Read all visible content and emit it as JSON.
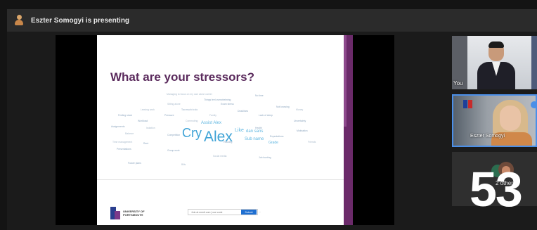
{
  "topbar": {
    "presenting_text": "Eszter Somogyi is presenting",
    "icon": "presenter-avatar-icon"
  },
  "slide": {
    "title": "What are your stressors?",
    "word_cloud": {
      "large_words": [
        "Cry",
        "Alex"
      ],
      "medium_words": [
        "Like",
        "dan sans",
        "Sub name",
        "Assist Alex",
        "Grade"
      ],
      "small_words": [
        "Managing to focus on my own alone career",
        "No time",
        "Things feel overwhelming",
        "Sitting alone",
        "Exam stress",
        "Not knowing",
        "Leaving work",
        "Too much to do",
        "Deadlines",
        "Money",
        "Feeling stuck",
        "Pressure",
        "Family",
        "Lack of sleep",
        "Workload",
        "Commuting",
        "Uncertainty",
        "Assignments",
        "Isolation",
        "Health",
        "Motivation",
        "Balance",
        "Competition",
        "Expectations",
        "Time management",
        "Rent",
        "Housing",
        "Friends",
        "Presentations",
        "Group work",
        "Social media",
        "Job hunting",
        "Future plans",
        "Bills"
      ]
    },
    "logo_text": [
      "UNIVERSITY OF",
      "PORTSMOUTH"
    ],
    "form": {
      "placeholder": "Join at menti.com | use code",
      "button_label": "Submit",
      "extra": "..."
    },
    "colors": {
      "title": "#5a2a5c",
      "accent_bar": "#6b2a6a",
      "word_cloud": "#3fa3d6"
    }
  },
  "participants": [
    {
      "name": "You",
      "tile": "speaker-tile"
    },
    {
      "name": "Eszter Somogyi",
      "tile": "active-speaker-tile"
    },
    {
      "name": "2 others",
      "tile": "others-tile"
    }
  ],
  "participant_count": "53"
}
